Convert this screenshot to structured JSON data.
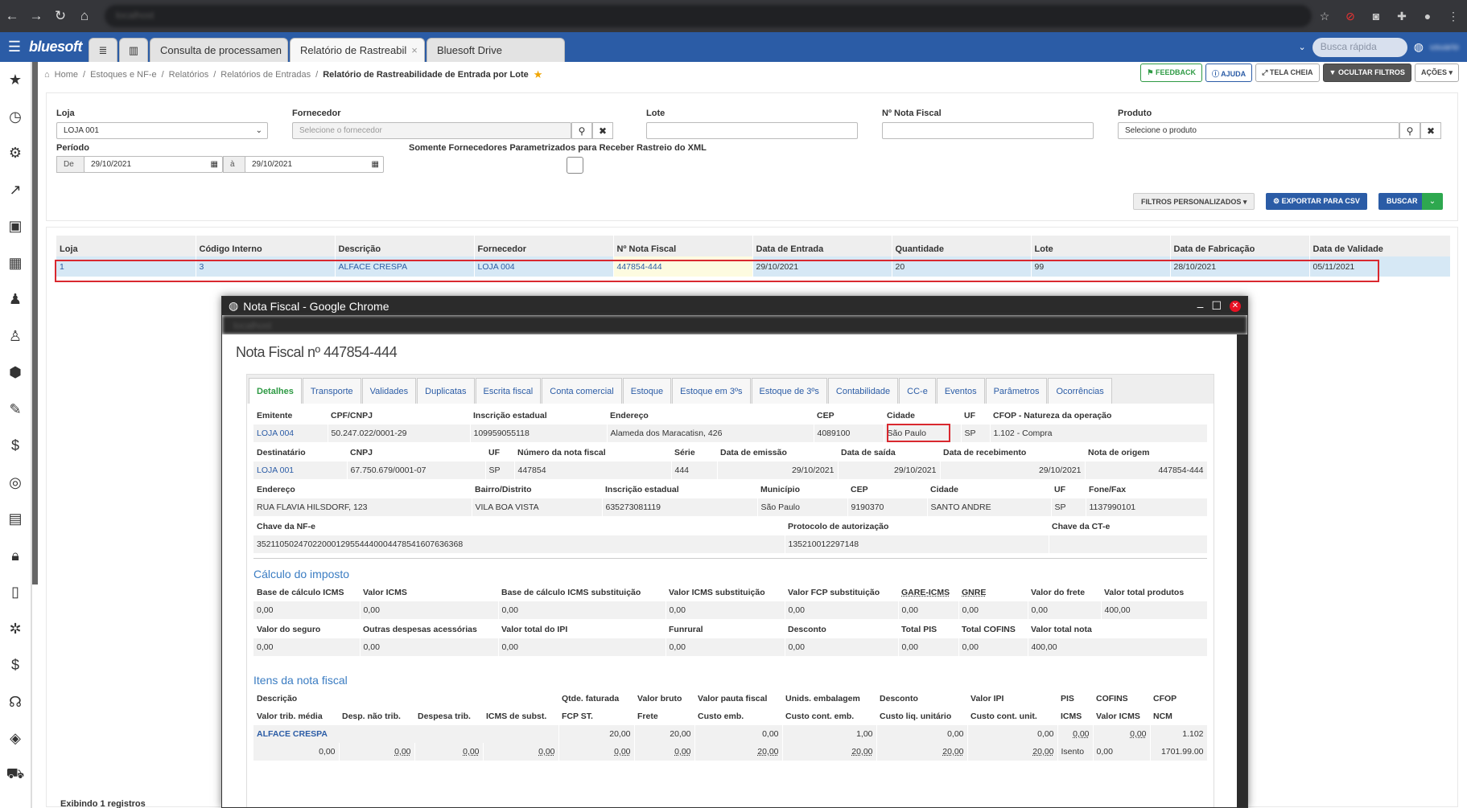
{
  "browser": {
    "url": "localhost"
  },
  "app": {
    "logo": "bluesoft",
    "tabs": [
      {
        "label": "Consulta de processamen"
      },
      {
        "label": "Relatório de Rastreabil"
      },
      {
        "label": "Bluesoft Drive"
      }
    ],
    "quick_search_placeholder": "Busca rápida",
    "user": "usuario"
  },
  "breadcrumb": {
    "items": [
      "Home",
      "Estoques e NF-e",
      "Relatórios",
      "Relatórios de Entradas"
    ],
    "current": "Relatório de Rastreabilidade de Entrada por Lote"
  },
  "toolbar": {
    "feedback": "FEEDBACK",
    "ajuda": "AJUDA",
    "tela_cheia": "TELA CHEIA",
    "ocultar_filtros": "OCULTAR FILTROS",
    "acoes": "AÇÕES"
  },
  "filters": {
    "loja_label": "Loja",
    "loja_value": "LOJA 001",
    "fornecedor_label": "Fornecedor",
    "fornecedor_placeholder": "Selecione o fornecedor",
    "lote_label": "Lote",
    "nf_label": "Nº Nota Fiscal",
    "produto_label": "Produto",
    "produto_placeholder": "Selecione o produto",
    "periodo_label": "Período",
    "de": "De",
    "data_de": "29/10/2021",
    "ate": "à",
    "data_ate": "29/10/2021",
    "somente_label": "Somente Fornecedores Parametrizados para Receber Rastreio do XML",
    "filtros_personalizados": "FILTROS PERSONALIZADOS",
    "exportar": "EXPORTAR PARA CSV",
    "buscar": "BUSCAR"
  },
  "results": {
    "columns": [
      "Loja",
      "Código Interno",
      "Descrição",
      "Fornecedor",
      "Nº Nota Fiscal",
      "Data de Entrada",
      "Quantidade",
      "Lote",
      "Data de Fabricação",
      "Data de Validade"
    ],
    "rows": [
      [
        "1",
        "3",
        "ALFACE CRESPA",
        "LOJA 004",
        "447854-444",
        "29/10/2021",
        "20",
        "99",
        "28/10/2021",
        "05/11/2021"
      ]
    ],
    "footer": "Exibindo 1 registros"
  },
  "popup": {
    "window_title": "Nota Fiscal - Google Chrome",
    "url": "localhost",
    "title": "Nota Fiscal nº 447854-444",
    "tabs": [
      "Detalhes",
      "Transporte",
      "Validades",
      "Duplicatas",
      "Escrita fiscal",
      "Conta comercial",
      "Estoque",
      "Estoque em 3ºs",
      "Estoque de 3ºs",
      "Contabilidade",
      "CC-e",
      "Eventos",
      "Parâmetros",
      "Ocorrências"
    ],
    "det1": {
      "headers": [
        "Emitente",
        "CPF/CNPJ",
        "Inscrição estadual",
        "Endereço",
        "CEP",
        "Cidade",
        "UF",
        "CFOP - Natureza da operação"
      ],
      "values": [
        "LOJA 004",
        "50.247.022/0001-29",
        "109959055118",
        "Alameda dos Maracatisn, 426",
        "4089100",
        "São Paulo",
        "SP",
        "1.102 - Compra"
      ]
    },
    "det2": {
      "headers": [
        "Destinatário",
        "CNPJ",
        "UF",
        "Número da nota fiscal",
        "Série",
        "Data de emissão",
        "Data de saída",
        "Data de recebimento",
        "Nota de origem"
      ],
      "values": [
        "LOJA 001",
        "67.750.679/0001-07",
        "SP",
        "447854",
        "444",
        "29/10/2021",
        "29/10/2021",
        "29/10/2021",
        "447854-444"
      ]
    },
    "det3": {
      "headers": [
        "Endereço",
        "Bairro/Distrito",
        "Inscrição estadual",
        "Município",
        "CEP",
        "Cidade",
        "UF",
        "Fone/Fax"
      ],
      "values": [
        "RUA FLAVIA HILSDORF, 123",
        "VILA BOA VISTA",
        "635273081119",
        "São Paulo",
        "9190370",
        "SANTO ANDRE",
        "SP",
        "1137990101"
      ]
    },
    "det4": {
      "headers": [
        "Chave da NF-e",
        "Protocolo de autorização",
        "Chave da CT-e"
      ],
      "values": [
        "35211050247022000129554440004478541607636368",
        "135210012297148",
        ""
      ]
    },
    "calc_title": "Cálculo do imposto",
    "calc1": {
      "headers": [
        "Base de cálculo ICMS",
        "Valor ICMS",
        "Base de cálculo ICMS substituição",
        "Valor ICMS substituição",
        "Valor FCP substituição",
        "GARE-ICMS",
        "GNRE",
        "Valor do frete",
        "Valor total produtos"
      ],
      "values": [
        "0,00",
        "0,00",
        "0,00",
        "0,00",
        "0,00",
        "0,00",
        "0,00",
        "0,00",
        "400,00"
      ]
    },
    "calc2": {
      "headers": [
        "Valor do seguro",
        "Outras despesas acessórias",
        "Valor total do IPI",
        "Funrural",
        "Desconto",
        "Total PIS",
        "Total COFINS",
        "Valor total nota"
      ],
      "values": [
        "0,00",
        "0,00",
        "0,00",
        "0,00",
        "0,00",
        "0,00",
        "0,00",
        "400,00"
      ]
    },
    "itens_title": "Itens da nota fiscal",
    "itens_h1": [
      "Descrição",
      "Qtde. faturada",
      "Valor bruto",
      "Valor pauta fiscal",
      "Unids. embalagem",
      "Desconto",
      "Valor IPI",
      "PIS",
      "COFINS",
      "CFOP"
    ],
    "itens_h2": [
      "Valor trib. média",
      "Desp. não trib.",
      "Despesa trib.",
      "ICMS de subst.",
      "FCP ST.",
      "Frete",
      "Custo emb.",
      "Custo cont. emb.",
      "Custo liq. unitário",
      "Custo cont. unit.",
      "ICMS",
      "Valor ICMS",
      "NCM"
    ],
    "itens_r1": [
      "ALFACE CRESPA",
      "20,00",
      "20,00",
      "0,00",
      "1,00",
      "0,00",
      "0,00",
      "0,00",
      "0,00",
      "1.102"
    ],
    "itens_r2": [
      "0,00",
      "0,00",
      "0,00",
      "0,00",
      "0,00",
      "0,00",
      "20,00",
      "20,00",
      "20,00",
      "20,00",
      "Isento",
      "0,00",
      "1701.99.00"
    ]
  }
}
